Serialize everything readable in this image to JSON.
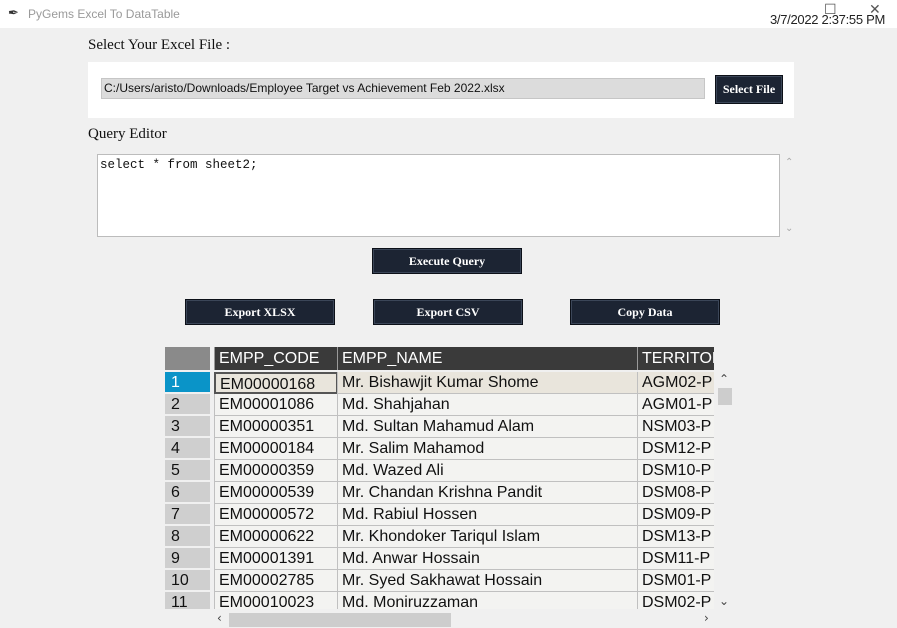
{
  "window": {
    "title": "PyGems Excel To DataTable",
    "app_icon": "feather-icon",
    "minimize_glyph": "☐",
    "close_glyph": "✕"
  },
  "timestamp": "3/7/2022 2:37:55 PM",
  "file": {
    "label": "Select Your Excel File :",
    "path": "C:/Users/aristo/Downloads/Employee Target vs Achievement Feb 2022.xlsx",
    "button": "Select File"
  },
  "query": {
    "label": "Query Editor",
    "text": "select * from sheet2;"
  },
  "buttons": {
    "execute": "Execute Query",
    "export_xlsx": "Export XLSX",
    "export_csv": "Export CSV",
    "copy": "Copy Data"
  },
  "table": {
    "columns": [
      "EMPP_CODE",
      "EMPP_NAME",
      "TERRITORY"
    ],
    "selected_row": 1,
    "rows": [
      {
        "n": "1",
        "code": "EM00000168",
        "name": "Mr. Bishawjit Kumar Shome",
        "territory": "AGM02-P"
      },
      {
        "n": "2",
        "code": "EM00001086",
        "name": "Md. Shahjahan",
        "territory": "AGM01-P"
      },
      {
        "n": "3",
        "code": "EM00000351",
        "name": "Md. Sultan Mahamud Alam",
        "territory": "NSM03-P"
      },
      {
        "n": "4",
        "code": "EM00000184",
        "name": "Mr. Salim Mahamod",
        "territory": "DSM12-P"
      },
      {
        "n": "5",
        "code": "EM00000359",
        "name": "Md. Wazed Ali",
        "territory": "DSM10-P"
      },
      {
        "n": "6",
        "code": "EM00000539",
        "name": "Mr. Chandan Krishna Pandit",
        "territory": "DSM08-P"
      },
      {
        "n": "7",
        "code": "EM00000572",
        "name": "Md. Rabiul Hossen",
        "territory": "DSM09-P"
      },
      {
        "n": "8",
        "code": "EM00000622",
        "name": "Mr. Khondoker Tariqul Islam",
        "territory": "DSM13-P"
      },
      {
        "n": "9",
        "code": "EM00001391",
        "name": "Md. Anwar Hossain",
        "territory": "DSM11-P"
      },
      {
        "n": "10",
        "code": "EM00002785",
        "name": "Mr. Syed Sakhawat Hossain",
        "territory": "DSM01-P"
      },
      {
        "n": "11",
        "code": "EM00010023",
        "name": "Md. Moniruzzaman",
        "territory": "DSM02-P"
      }
    ]
  },
  "colors": {
    "button_bg": "#1c2433",
    "header_bg": "#3a3a3a",
    "selected_rownum": "#0a94c8"
  }
}
